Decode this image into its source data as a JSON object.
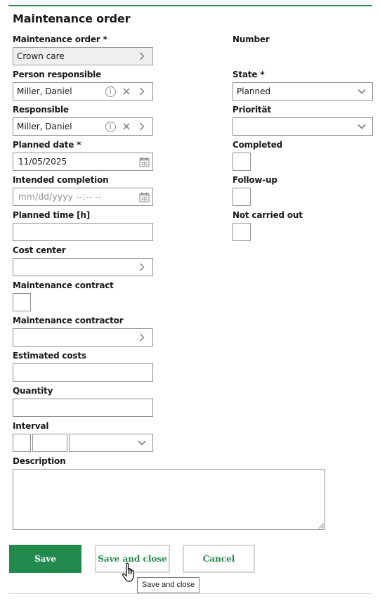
{
  "form": {
    "title": "Maintenance order",
    "fields": {
      "maintenance_order": {
        "label": "Maintenance order *",
        "value": "Crown care"
      },
      "number": {
        "label": "Number"
      },
      "person_responsible": {
        "label": "Person responsible",
        "value": "Miller, Daniel"
      },
      "state": {
        "label": "State *",
        "value": "Planned"
      },
      "responsible": {
        "label": "Responsible",
        "value": "Miller, Daniel"
      },
      "priority": {
        "label": "Priorität",
        "value": ""
      },
      "planned_date": {
        "label": "Planned date *",
        "value": "11/05/2025"
      },
      "completed": {
        "label": "Completed",
        "checked": false
      },
      "intended_completion": {
        "label": "Intended completion",
        "placeholder": "mm/dd/yyyy --:-- --"
      },
      "follow_up": {
        "label": "Follow-up",
        "checked": false
      },
      "planned_time": {
        "label": "Planned time [h]",
        "value": ""
      },
      "not_carried_out": {
        "label": "Not carried out",
        "checked": false
      },
      "cost_center": {
        "label": "Cost center",
        "value": ""
      },
      "maintenance_contract": {
        "label": "Maintenance contract",
        "checked": false
      },
      "maintenance_contractor": {
        "label": "Maintenance contractor",
        "value": ""
      },
      "estimated_costs": {
        "label": "Estimated costs",
        "value": ""
      },
      "quantity": {
        "label": "Quantity",
        "value": ""
      },
      "interval": {
        "label": "Interval",
        "value_a": "",
        "value_b": "",
        "unit": ""
      },
      "description": {
        "label": "Description",
        "value": ""
      }
    }
  },
  "buttons": {
    "save": "Save",
    "save_and_close": "Save and close",
    "cancel": "Cancel"
  },
  "tooltip": "Save and close",
  "icons": {
    "lookup": "chevron-right-icon",
    "info": "info-icon",
    "clear": "clear-icon",
    "dropdown": "chevron-down-icon",
    "calendar": "calendar-icon",
    "cursor": "hand-pointer-cursor"
  },
  "colors": {
    "accent": "#218a4c",
    "top_rule": "#2e8b57",
    "readonly_bg": "#efefef"
  }
}
